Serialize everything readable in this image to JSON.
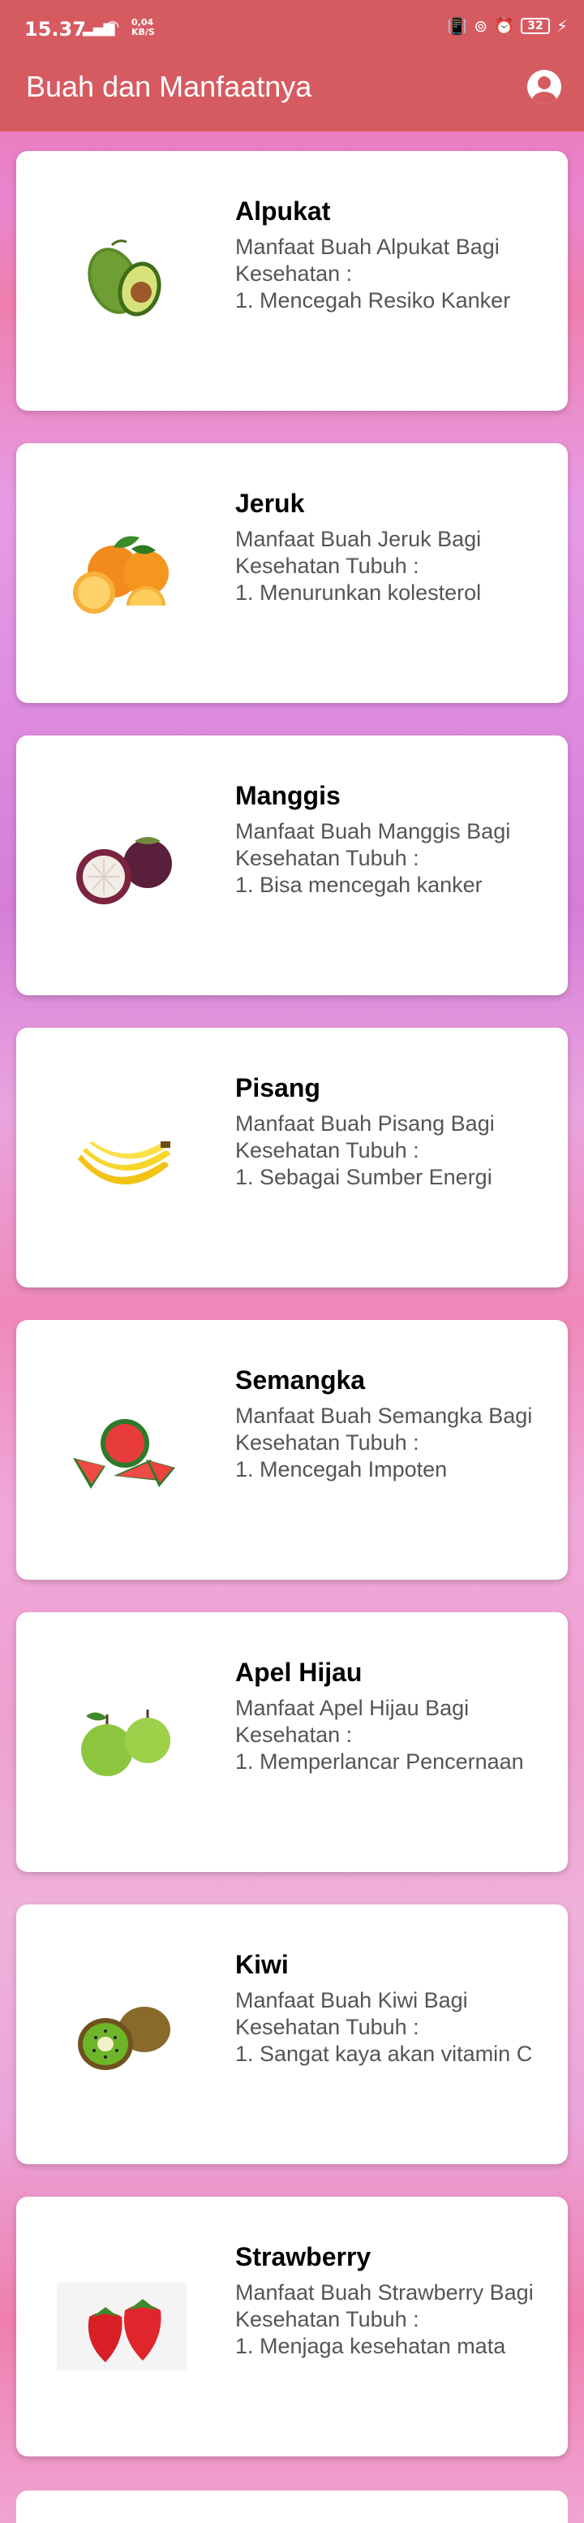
{
  "status_bar": {
    "time": "15.37",
    "speed_value": "0,04",
    "speed_unit": "KB/S",
    "battery": "32"
  },
  "app_bar": {
    "title": "Buah dan Manfaatnya"
  },
  "cards": [
    {
      "title": "Alpukat",
      "description": "Manfaat Buah Alpukat Bagi\nKesehatan :\n1.  Mencegah Resiko Kanker"
    },
    {
      "title": "Jeruk",
      "description": "Manfaat Buah Jeruk Bagi\nKesehatan Tubuh :\n1. Menurunkan kolesterol"
    },
    {
      "title": "Manggis",
      "description": "Manfaat Buah Manggis Bagi\nKesehatan Tubuh :\n1. Bisa mencegah kanker"
    },
    {
      "title": "Pisang",
      "description": "Manfaat Buah Pisang Bagi\nKesehatan Tubuh :\n1. Sebagai Sumber Energi"
    },
    {
      "title": "Semangka",
      "description": "Manfaat Buah Semangka Bagi\nKesehatan Tubuh :\n1. Mencegah Impoten"
    },
    {
      "title": "Apel Hijau",
      "description": "Manfaat Apel Hijau Bagi\nKesehatan :\n1. Memperlancar Pencernaan"
    },
    {
      "title": "Kiwi",
      "description": "Manfaat Buah Kiwi Bagi\nKesehatan Tubuh :\n1. Sangat kaya akan vitamin C"
    },
    {
      "title": "Strawberry",
      "description": "Manfaat Buah Strawberry Bagi\nKesehatan Tubuh :\n1. Menjaga kesehatan mata"
    }
  ]
}
